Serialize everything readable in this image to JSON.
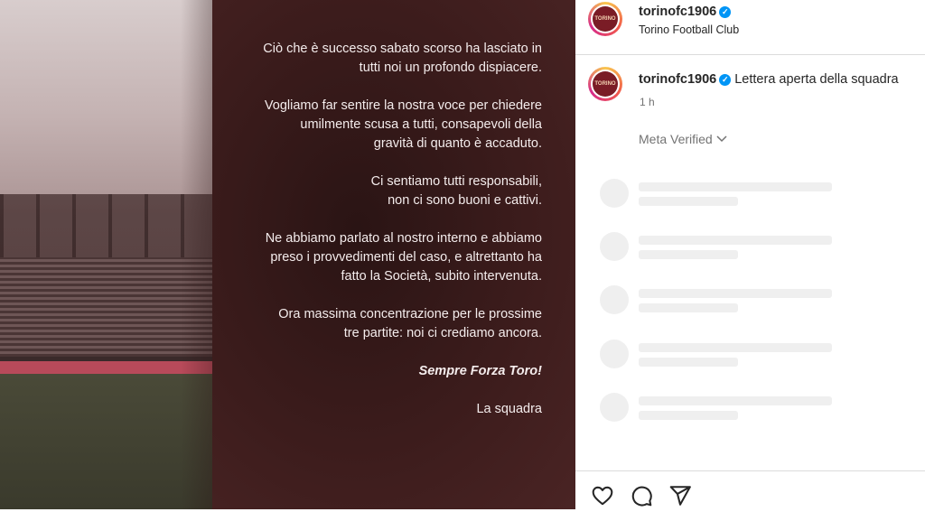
{
  "letter": {
    "paragraphs": [
      "Ciò che è successo sabato scorso ha lasciato in\ntutti noi un profondo dispiacere.",
      "Vogliamo far sentire la nostra voce per chiedere\numilmente scusa a tutti, consapevoli della\ngravità di quanto è accaduto.",
      "Ci sentiamo tutti responsabili,\nnon ci sono buoni e cattivi.",
      "Ne abbiamo parlato al nostro interno e abbiamo\npreso i provvedimenti del caso, e altrettanto ha\nfatto la Società, subito intervenuta.",
      "Ora massima concentrazione per le prossime\ntre partite: noi ci crediamo ancora."
    ],
    "motto": "Sempre Forza Toro!",
    "signature": "La squadra"
  },
  "header": {
    "username": "torinofc1906",
    "subtitle": "Torino Football Club",
    "avatar_text": "TORINO"
  },
  "caption": {
    "username": "torinofc1906",
    "text": "Lettera aperta della squadra",
    "time": "1 h"
  },
  "meta_verified": "Meta Verified",
  "colors": {
    "verified": "#0095f6",
    "club": "#7a1c26"
  },
  "icons": [
    "heart-icon",
    "comment-icon",
    "share-icon"
  ]
}
